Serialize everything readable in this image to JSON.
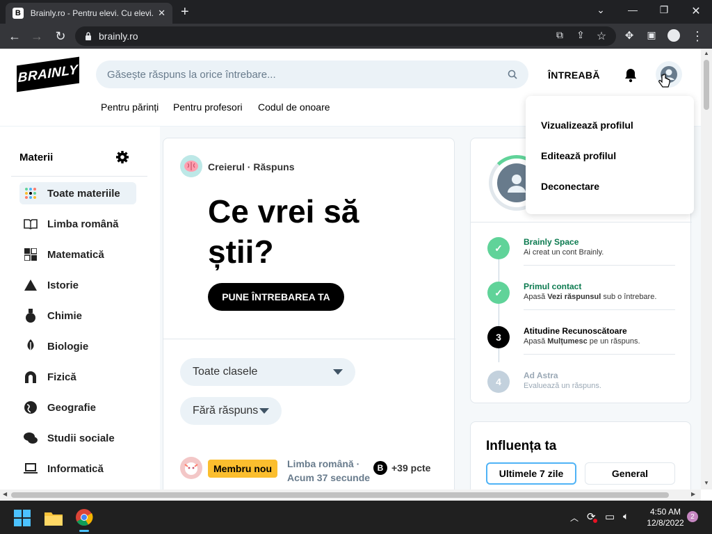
{
  "browser": {
    "tab_title": "Brainly.ro - Pentru elevi. Cu elevi.",
    "tab_close": "✕",
    "new_tab": "+",
    "url": "brainly.ro"
  },
  "header": {
    "logo_text": "BRAINLY",
    "search_placeholder": "Găsește răspuns la orice întrebare...",
    "ask_label": "ÎNTREABĂ",
    "links": [
      "Pentru părinți",
      "Pentru profesori",
      "Codul de onoare"
    ]
  },
  "sidebar": {
    "title": "Materii",
    "items": [
      {
        "label": "Toate materiile",
        "icon": "all-subjects-icon"
      },
      {
        "label": "Limba română",
        "icon": "book-icon"
      },
      {
        "label": "Matematică",
        "icon": "math-icon"
      },
      {
        "label": "Istorie",
        "icon": "history-icon"
      },
      {
        "label": "Chimie",
        "icon": "flask-icon"
      },
      {
        "label": "Biologie",
        "icon": "leaf-icon"
      },
      {
        "label": "Fizică",
        "icon": "magnet-icon"
      },
      {
        "label": "Geografie",
        "icon": "globe-icon"
      },
      {
        "label": "Studii sociale",
        "icon": "chat-icon"
      },
      {
        "label": "Informatică",
        "icon": "laptop-icon"
      }
    ]
  },
  "hero": {
    "brand": "Creierul · Răspuns",
    "heading_line1": "Ce vrei să",
    "heading_line2": "știi?",
    "cta": "PUNE ÎNTREBAREA TA"
  },
  "filters": {
    "grade": "Toate clasele",
    "status": "Fără răspuns"
  },
  "question": {
    "badge": "Membru nou",
    "subject": "Limba română ·",
    "time": "Acum 37 secunde",
    "points": "+39 pcte",
    "points_icon": "B"
  },
  "progress": {
    "steps": [
      {
        "title": "Brainly Space",
        "desc": "Ai creat un cont Brainly.",
        "state": "done",
        "num": "✓"
      },
      {
        "title": "Primul contact",
        "desc_prefix": "Apasă ",
        "desc_bold": "Vezi răspunsul",
        "desc_suffix": " sub o întrebare.",
        "state": "done",
        "num": "✓"
      },
      {
        "title": "Atitudine Recunoscătoare",
        "desc_prefix": "Apasă ",
        "desc_bold": "Mulțumesc",
        "desc_suffix": " pe un răspuns.",
        "state": "active",
        "num": "3"
      },
      {
        "title": "Ad Astra",
        "desc": "Evaluează un răspuns.",
        "state": "locked",
        "num": "4"
      }
    ],
    "colors": {
      "done": "#60d399",
      "active": "#000000",
      "locked": "#c3d1dd"
    }
  },
  "influence": {
    "title": "Influența ta",
    "tab_week": "Ultimele 7 zile",
    "tab_general": "General"
  },
  "profile_menu": {
    "items": [
      "Vizualizează profilul",
      "Editează profilul",
      "Deconectare"
    ]
  },
  "taskbar": {
    "time": "4:50 AM",
    "date": "12/8/2022",
    "notifications": "2"
  }
}
